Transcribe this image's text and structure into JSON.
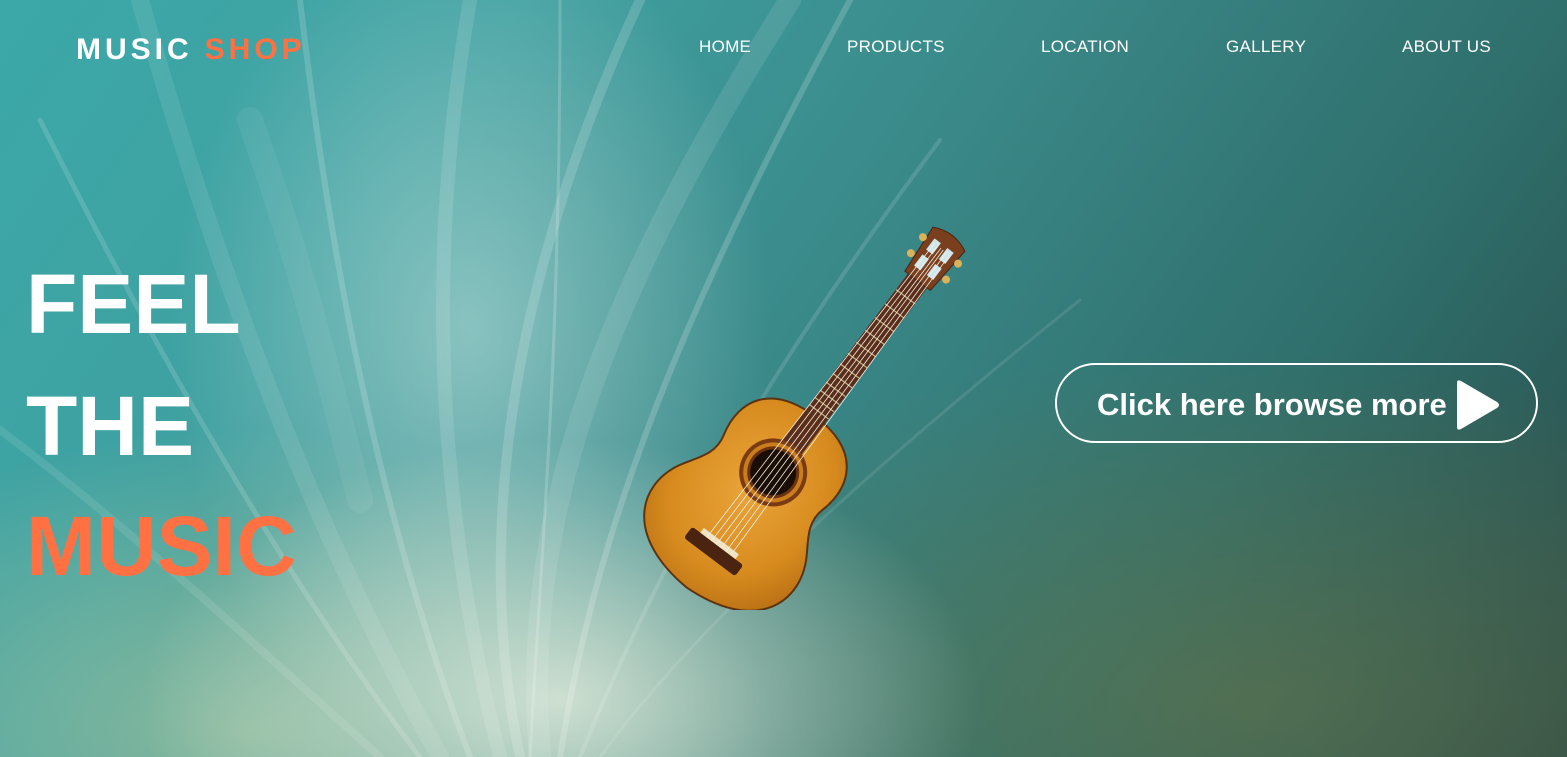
{
  "brand": {
    "name_primary": "MUSIC",
    "name_accent": "SHOP",
    "accent_color": "#ff7043"
  },
  "nav": {
    "items": [
      {
        "label": "HOME"
      },
      {
        "label": "PRODUCTS"
      },
      {
        "label": "LOCATION"
      },
      {
        "label": "GALLERY"
      },
      {
        "label": "ABOUT US"
      }
    ]
  },
  "hero": {
    "line1": "FEEL",
    "line2": "THE",
    "line3": "MUSIC",
    "image": "acoustic-guitar"
  },
  "cta": {
    "label": "Click here browse more",
    "icon": "play-icon"
  }
}
